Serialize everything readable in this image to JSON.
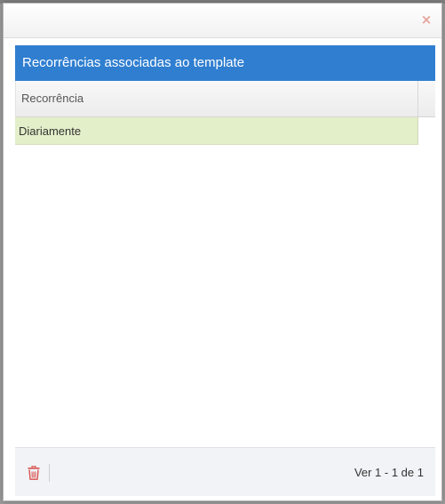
{
  "dialog": {
    "close_glyph": "×",
    "title": "Recorrências associadas ao template"
  },
  "grid": {
    "columns": [
      "Recorrência"
    ],
    "rows": [
      {
        "recorrencia": "Diariamente"
      }
    ]
  },
  "pager": {
    "delete_icon": "trash-icon",
    "record_info": "Ver 1 - 1 de 1"
  },
  "colors": {
    "caption_bg": "#2f7ed0",
    "selected_row_bg": "#e3efc9",
    "close_icon": "#e6a39b",
    "trash_icon": "#d9534f"
  }
}
